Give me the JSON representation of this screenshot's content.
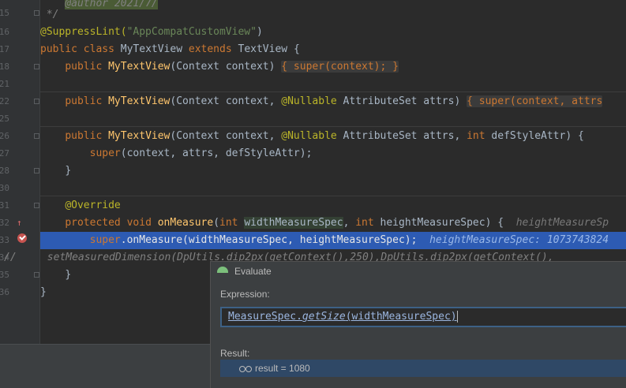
{
  "editor": {
    "line_numbers": [
      "15",
      "16",
      "17",
      "18",
      "21",
      "22",
      "25",
      "26",
      "27",
      "28",
      "30",
      "31",
      "32",
      "33",
      "34",
      "35",
      "36"
    ],
    "top_fragment": "@author 2021/7/",
    "comment_end": " */",
    "annotation_suppress": "@SuppressLint(",
    "annotation_suppress_arg": "\"AppCompatCustomView\"",
    "annotation_suppress_close": ")",
    "class_kw_public": "public",
    "class_kw_class": "class",
    "class_name": "MyTextView",
    "class_kw_extends": "extends",
    "class_super": "TextView {",
    "ctor_name": "MyTextView",
    "ctor1_params": "(Context context)",
    "ctor1_body": "{ super(context); }",
    "ctor2_params": "(Context context, ",
    "nullable": "@Nullable",
    "attrset": " AttributeSet attrs) ",
    "ctor2_body": "{ super(context, attrs",
    "ctor3_tail": " AttributeSet attrs, ",
    "int_kw": "int",
    "ctor3_end": " defStyleAttr) {",
    "super_call3": "super",
    "super_args3": "(context, attrs, defStyleAttr);",
    "close_brace": "}",
    "override_ann": "@Override",
    "protected_kw": "protected",
    "void_kw": "void",
    "method_name": "onMeasure",
    "param1_type": "int",
    "param1_name": "widthMeasureSpec",
    "param2_type": "int",
    "param2_rest": " heightMeasureSpec) {",
    "inlay_hint_31": "heightMeasureSp",
    "exec_super": "super",
    "exec_call": ".onMeasure(widthMeasureSpec, heightMeasureSpec);",
    "inlay_hint_32": "heightMeasureSpec: 1073743824",
    "commented_line": "//     setMeasuredDimension(DpUtils.dip2px(getContext(),250),DpUtils.dip2px(getContext(),",
    "class_close": "}"
  },
  "evaluate_dialog": {
    "title": "Evaluate",
    "expression_label": "Expression:",
    "expression_prefix": "MeasureSpec.",
    "expression_method": "getSize",
    "expression_args": "(widthMeasureSpec)",
    "result_label": "Result:",
    "result_text": "result = 1080"
  },
  "colors": {
    "background": "#2b2b2b",
    "keyword": "#cc7832",
    "function": "#ffc66d",
    "string": "#6a8759",
    "execution_line": "#2d5bb3",
    "breakpoint": "#c75450"
  }
}
